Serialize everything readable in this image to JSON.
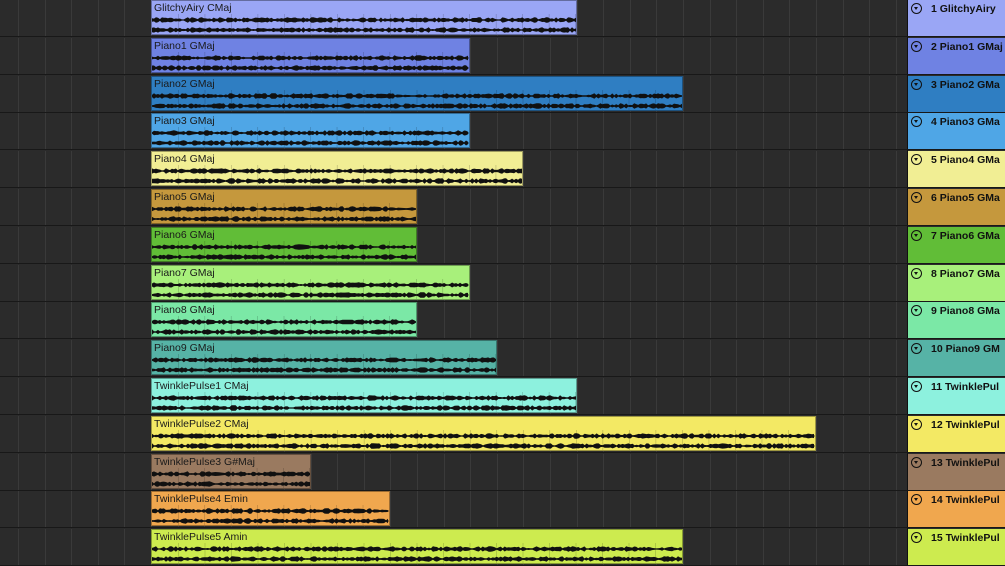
{
  "tracks": [
    {
      "number": "1",
      "header_label": "1 GlitchyAiry",
      "clip_name": "GlitchyAiry CMaj",
      "color": "#9aa6f5",
      "clip_bars": 16
    },
    {
      "number": "2",
      "header_label": "2 Piano1 GMaj",
      "clip_name": "Piano1 GMaj",
      "color": "#6f82e3",
      "clip_bars": 12
    },
    {
      "number": "3",
      "header_label": "3 Piano2 GMa",
      "clip_name": "Piano2 GMaj",
      "color": "#2f7ec2",
      "clip_bars": 20
    },
    {
      "number": "4",
      "header_label": "4 Piano3 GMa",
      "clip_name": "Piano3 GMaj",
      "color": "#4fa6e6",
      "clip_bars": 12
    },
    {
      "number": "5",
      "header_label": "5 Piano4 GMa",
      "clip_name": "Piano4 GMaj",
      "color": "#f1ee94",
      "clip_bars": 14
    },
    {
      "number": "6",
      "header_label": "6 Piano5 GMa",
      "clip_name": "Piano5 GMaj",
      "color": "#c5983d",
      "clip_bars": 10
    },
    {
      "number": "7",
      "header_label": "7 Piano6 GMa",
      "clip_name": "Piano6 GMaj",
      "color": "#61bd37",
      "clip_bars": 10
    },
    {
      "number": "8",
      "header_label": "8 Piano7 GMa",
      "clip_name": "Piano7 GMaj",
      "color": "#a8f07b",
      "clip_bars": 12
    },
    {
      "number": "9",
      "header_label": "9 Piano8 GMa",
      "clip_name": "Piano8 GMaj",
      "color": "#7be8a6",
      "clip_bars": 10
    },
    {
      "number": "10",
      "header_label": "10 Piano9 GM",
      "clip_name": "Piano9 GMaj",
      "color": "#56b3a6",
      "clip_bars": 13
    },
    {
      "number": "11",
      "header_label": "11 TwinklePul",
      "clip_name": "TwinklePulse1 CMaj",
      "color": "#8df1de",
      "clip_bars": 16
    },
    {
      "number": "12",
      "header_label": "12 TwinklePul",
      "clip_name": "TwinklePulse2 CMaj",
      "color": "#f3e964",
      "clip_bars": 25
    },
    {
      "number": "13",
      "header_label": "13 TwinklePul",
      "clip_name": "TwinklePulse3 G#Maj",
      "color": "#9a7a60",
      "clip_bars": 6
    },
    {
      "number": "14",
      "header_label": "14 TwinklePul",
      "clip_name": "TwinklePulse4 Emin",
      "color": "#f0a74e",
      "clip_bars": 9
    },
    {
      "number": "15",
      "header_label": "15 TwinklePul",
      "clip_name": "TwinklePulse5 Amin",
      "color": "#cdeb4f",
      "clip_bars": 20
    }
  ],
  "colors": {
    "background": "#2b2b2b",
    "gridline": "#3a3a3a",
    "waveform": "#111111"
  }
}
